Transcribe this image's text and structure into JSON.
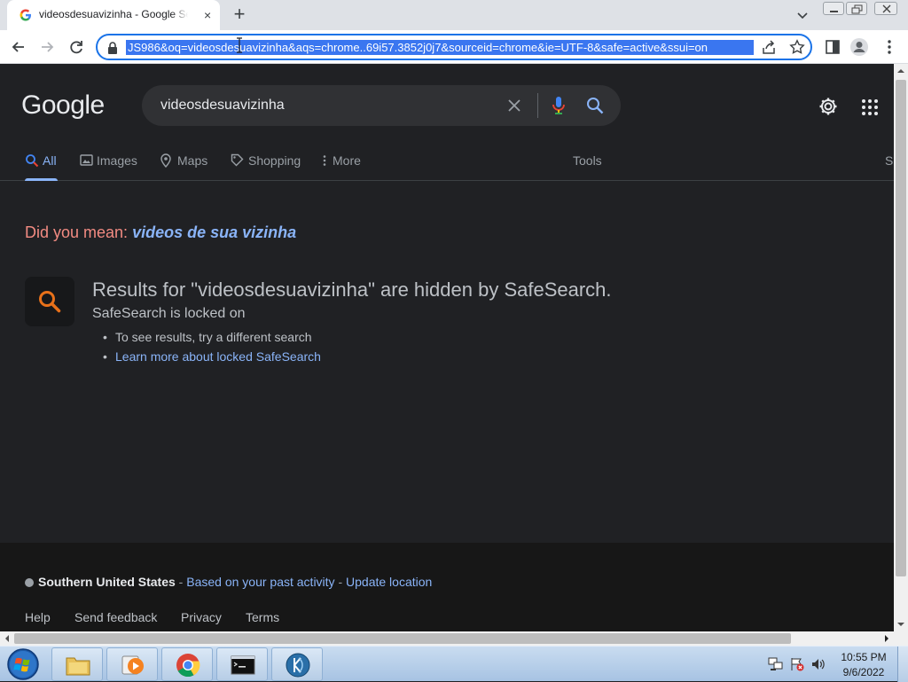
{
  "browser": {
    "tab_title": "videosdesuavizinha - Google Search",
    "tab_close": "×",
    "new_tab": "+",
    "url": "JS986&oq=videosdesuavizinha&aqs=chrome..69i57.3852j0j7&sourceid=chrome&ie=UTF-8&safe=active&ssui=on"
  },
  "google": {
    "logo": "Google",
    "query": "videosdesuavizinha",
    "tabs": [
      {
        "label": "All",
        "icon": "search-icon",
        "active": true
      },
      {
        "label": "Images",
        "icon": "image-icon"
      },
      {
        "label": "Maps",
        "icon": "map-pin-icon"
      },
      {
        "label": "Shopping",
        "icon": "tag-icon"
      },
      {
        "label": "More",
        "icon": "more-vertical-icon"
      }
    ],
    "tools_label": "Tools",
    "safesearch_clipped": "S",
    "did_you_mean_prefix": "Did you mean: ",
    "did_you_mean_suggestion": "videos de sua vizinha",
    "safesearch": {
      "title": "Results for \"videosdesuavizinha\" are hidden by SafeSearch.",
      "subtitle": "SafeSearch is locked on",
      "items": [
        "To see results, try a different search",
        "Learn more about locked SafeSearch"
      ]
    },
    "footer": {
      "location": "Southern United States",
      "separator1": " - ",
      "based_on": "Based on your past activity",
      "separator2": " - ",
      "update_location": "Update location",
      "links": [
        "Help",
        "Send feedback",
        "Privacy",
        "Terms"
      ]
    }
  },
  "taskbar": {
    "time": "10:55 PM",
    "date": "9/6/2022"
  },
  "colors": {
    "accent": "#8ab4f8",
    "did_you_mean": "#f28b82",
    "page_bg": "#202124"
  }
}
